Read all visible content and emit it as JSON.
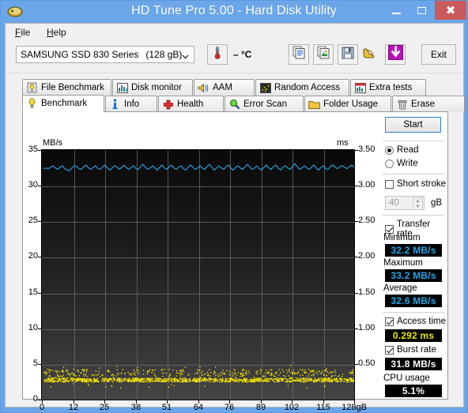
{
  "window": {
    "title": "HD Tune Pro 5.00 - Hard Disk Utility",
    "icon": "hdtune-app-icon",
    "buttons": {
      "minimize": "–",
      "maximize": "□",
      "close": "✕"
    },
    "titlebar_color": "#6aa6e8",
    "close_color": "#cb5a5a"
  },
  "menu": {
    "items": [
      "File",
      "Help"
    ]
  },
  "toolbar": {
    "drive": {
      "name": "SAMSUNG SSD 830 Series",
      "capacity": "(128 gB)"
    },
    "temperature": "– °C",
    "temp_icon": "thermometer-icon",
    "buttons": [
      {
        "name": "copy-text-icon",
        "label": ""
      },
      {
        "name": "copy-image-icon",
        "label": ""
      },
      {
        "name": "save-icon",
        "label": ""
      },
      {
        "name": "boots-icon",
        "label": ""
      },
      {
        "name": "download-icon",
        "label": ""
      }
    ],
    "exit_label": "Exit"
  },
  "tabs": {
    "row1": [
      {
        "label": "File Benchmark",
        "icon": "file-benchmark-icon",
        "active": false
      },
      {
        "label": "Disk monitor",
        "icon": "disk-monitor-icon",
        "active": false
      },
      {
        "label": "AAM",
        "icon": "speaker-icon",
        "active": false
      },
      {
        "label": "Random Access",
        "icon": "random-access-icon",
        "active": false
      },
      {
        "label": "Extra tests",
        "icon": "extra-tests-icon",
        "active": false
      }
    ],
    "row2": [
      {
        "label": "Benchmark",
        "icon": "bulb-icon",
        "active": true
      },
      {
        "label": "Info",
        "icon": "info-icon",
        "active": false
      },
      {
        "label": "Health",
        "icon": "health-cross-icon",
        "active": false
      },
      {
        "label": "Error Scan",
        "icon": "magnifier-icon",
        "active": false
      },
      {
        "label": "Folder Usage",
        "icon": "folder-icon",
        "active": false
      },
      {
        "label": "Erase",
        "icon": "trash-icon",
        "active": false
      }
    ]
  },
  "controls": {
    "start_label": "Start",
    "mode": {
      "read_label": "Read",
      "write_label": "Write",
      "selected": "Read"
    },
    "short_stroke": {
      "label": "Short stroke",
      "checked": false,
      "value": "40",
      "unit": "gB"
    },
    "transfer_rate": {
      "label": "Transfer rate",
      "checked": true
    },
    "access_time": {
      "label": "Access time",
      "checked": true
    },
    "burst_rate": {
      "label": "Burst rate",
      "checked": true
    }
  },
  "results": {
    "minimum": {
      "label": "Minimum",
      "value": "32.2 MB/s",
      "color": "#1ea8ea"
    },
    "maximum": {
      "label": "Maximum",
      "value": "33.2 MB/s",
      "color": "#1ea8ea"
    },
    "average": {
      "label": "Average",
      "value": "32.6 MB/s",
      "color": "#1ea8ea"
    },
    "access_time": {
      "label": "Access time",
      "value": "0.292 ms",
      "color": "#e8e800"
    },
    "burst_rate": {
      "label": "Burst rate",
      "value": "31.8 MB/s",
      "color": "#ffffff"
    },
    "cpu_usage": {
      "label": "CPU usage",
      "value": "5.1%",
      "color": "#ffffff"
    }
  },
  "chart_data": {
    "type": "line",
    "title": "",
    "ylabel": "MB/s",
    "ylabel_right": "ms",
    "xlabel": "gB",
    "ylim": [
      0,
      35
    ],
    "ylim_right": [
      0,
      3.5
    ],
    "xlim": [
      0,
      128
    ],
    "yticks": [
      35,
      30,
      25,
      20,
      15,
      10,
      5,
      0
    ],
    "yticks_right": [
      "3.50",
      "3.00",
      "2.50",
      "2.00",
      "1.50",
      "1.00",
      "0.50"
    ],
    "xticks": [
      "0",
      "12",
      "25",
      "38",
      "51",
      "64",
      "76",
      "89",
      "102",
      "115",
      "128gB"
    ],
    "grid": true,
    "legend_position": "none",
    "series": [
      {
        "name": "Transfer rate",
        "axis": "left",
        "color": "#2aa8e8",
        "style": "line",
        "values": [
          32.5,
          32.6,
          32.5,
          32.7,
          32.9,
          32.6,
          32.4,
          32.7,
          32.9,
          32.5,
          32.3,
          32.2,
          32.6,
          32.9,
          32.8,
          32.5,
          32.4,
          32.8,
          33.0,
          32.6,
          32.4,
          32.7,
          32.9,
          32.5,
          32.4,
          32.8,
          33.0,
          32.6,
          32.3,
          32.6,
          32.9,
          32.7,
          32.4,
          32.7,
          33.0,
          32.6,
          32.4,
          32.7,
          32.9,
          32.5,
          32.4,
          32.8,
          33.1,
          32.7,
          32.4,
          32.6,
          32.9,
          32.6,
          32.3,
          32.7,
          33.0,
          32.6,
          32.4,
          32.8,
          33.0,
          32.6,
          32.4,
          32.7,
          32.9,
          32.5,
          32.3,
          32.7,
          33.0,
          32.7,
          32.4,
          32.6,
          32.9,
          32.6,
          32.4,
          32.8,
          33.1,
          32.7,
          32.3,
          32.6,
          32.9,
          32.6,
          32.4,
          32.8,
          33.0,
          32.6,
          32.3,
          32.7,
          32.9,
          32.6,
          32.4,
          32.8,
          33.1,
          32.7,
          32.4,
          32.6,
          32.9,
          32.5,
          32.3,
          32.7,
          33.0,
          32.6,
          32.4,
          32.8,
          33.0,
          32.6,
          32.3,
          32.7,
          32.9,
          32.6,
          32.4,
          32.8,
          33.2,
          32.8,
          32.4,
          32.6,
          32.9,
          32.6,
          32.4,
          32.7,
          33.0,
          32.6,
          32.3,
          32.7,
          32.9,
          32.5,
          32.4,
          32.8,
          33.0,
          32.7,
          32.5,
          32.8,
          32.9,
          32.7,
          32.5,
          32.8,
          33.0,
          32.7
        ]
      },
      {
        "name": "Access time",
        "axis": "right",
        "color": "#ffee00",
        "style": "scatter",
        "mean_ms": 0.292,
        "spread_ms": [
          0.18,
          0.5
        ]
      }
    ]
  }
}
